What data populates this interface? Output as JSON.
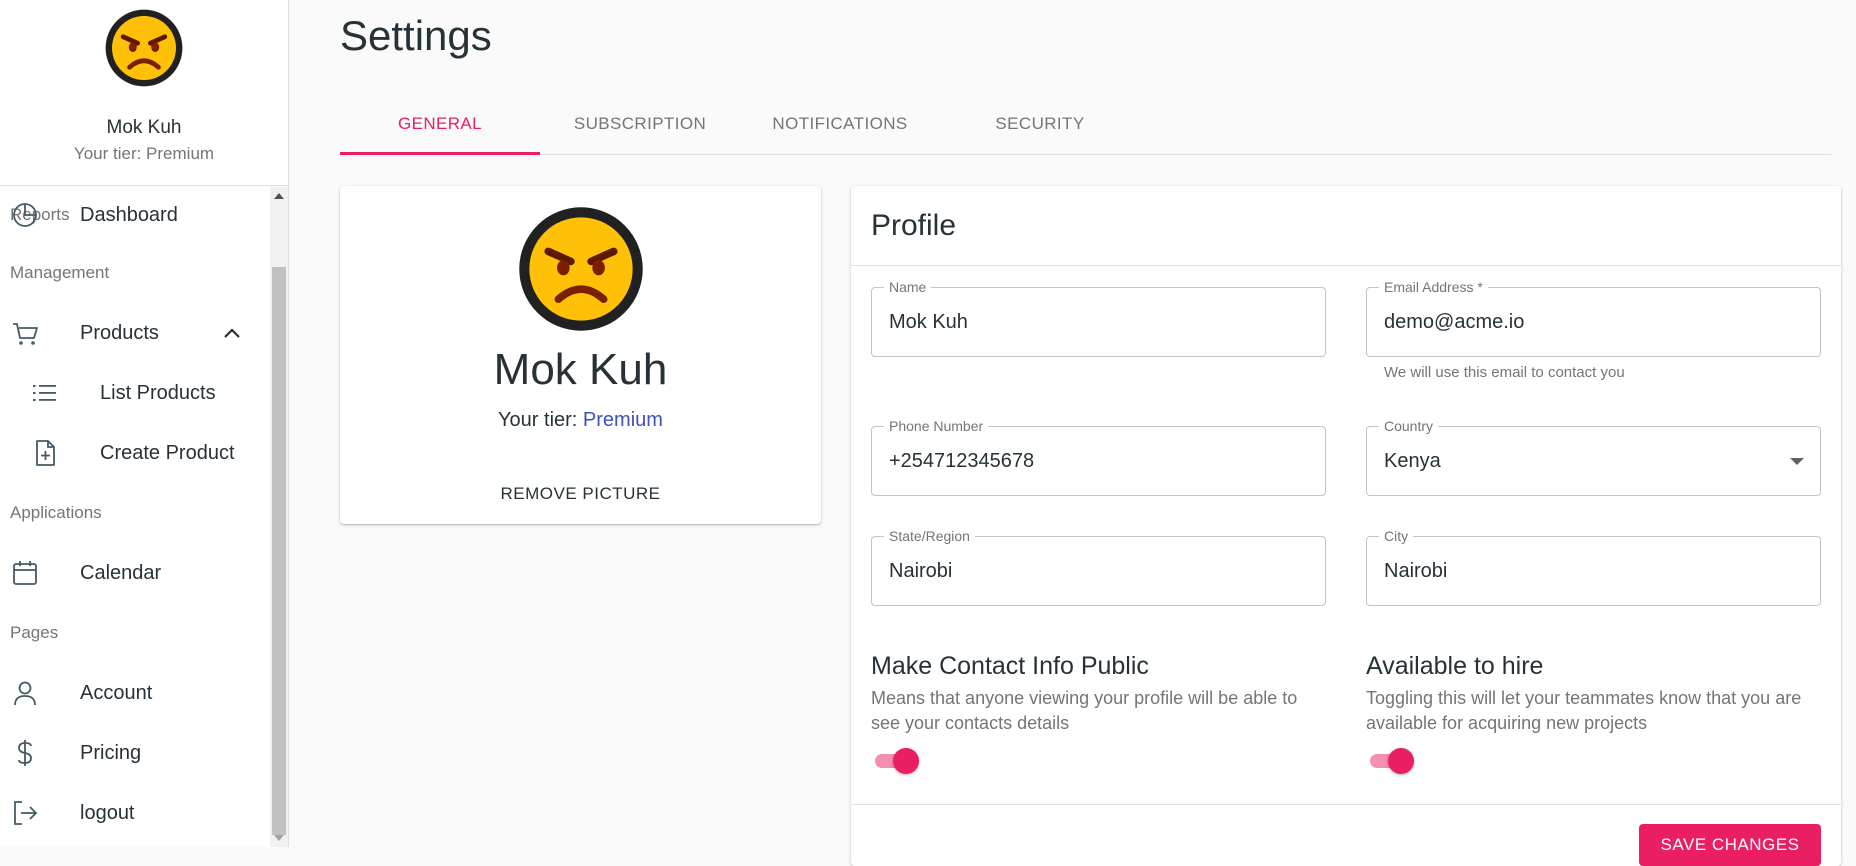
{
  "sidebar": {
    "user_name": "Mok Kuh",
    "tier_text": "Your tier: Premium",
    "sections": {
      "reports": "Reports",
      "management": "Management",
      "applications": "Applications",
      "pages": "Pages"
    },
    "items": {
      "dashboard": "Dashboard",
      "products": "Products",
      "list_products": "List Products",
      "create_product": "Create Product",
      "calendar": "Calendar",
      "account": "Account",
      "pricing": "Pricing",
      "logout": "logout"
    }
  },
  "page": {
    "title": "Settings"
  },
  "tabs": [
    "GENERAL",
    "SUBSCRIPTION",
    "NOTIFICATIONS",
    "SECURITY"
  ],
  "profile_card": {
    "name": "Mok Kuh",
    "tier_label": "Your tier: ",
    "tier_value": "Premium",
    "remove_label": "REMOVE PICTURE"
  },
  "profile_form": {
    "heading": "Profile",
    "name": {
      "label": "Name",
      "value": "Mok Kuh"
    },
    "email": {
      "label": "Email Address *",
      "value": "demo@acme.io",
      "helper": "We will use this email to contact you"
    },
    "phone": {
      "label": "Phone Number",
      "value": "+254712345678"
    },
    "country": {
      "label": "Country",
      "value": "Kenya"
    },
    "state": {
      "label": "State/Region",
      "value": "Nairobi"
    },
    "city": {
      "label": "City",
      "value": "Nairobi"
    },
    "contact_public": {
      "title": "Make Contact Info Public",
      "description": "Means that anyone viewing your profile will be able to see your contacts details",
      "enabled": true
    },
    "available_hire": {
      "title": "Available to hire",
      "description": "Toggling this will let your teammates know that you are available for acquiring new projects",
      "enabled": true
    },
    "save_label": "SAVE CHANGES"
  },
  "colors": {
    "accent": "#e91e63",
    "link": "#3f51b5",
    "emoji_face": "#ffc107"
  }
}
